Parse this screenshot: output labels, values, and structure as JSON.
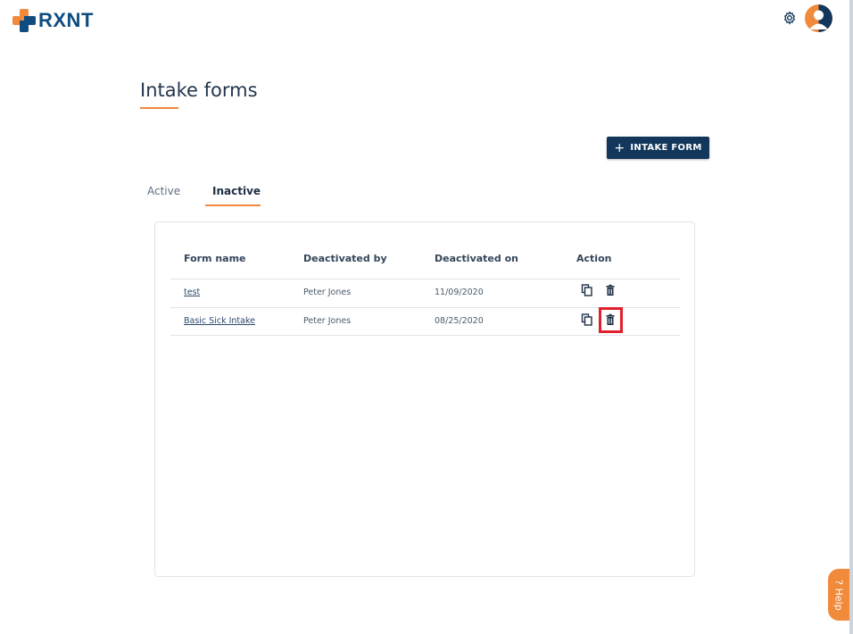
{
  "app": {
    "brand": "RXNT"
  },
  "header": {
    "settings_icon": "gear-icon",
    "avatar_icon": "user-avatar-icon"
  },
  "page": {
    "title": "Intake forms"
  },
  "toolbar": {
    "add_label": "INTAKE FORM",
    "add_icon": "plus-icon"
  },
  "tabs": [
    {
      "label": "Active",
      "selected": false
    },
    {
      "label": "Inactive",
      "selected": true
    }
  ],
  "table": {
    "columns": [
      "Form name",
      "Deactivated by",
      "Deactivated on",
      "Action"
    ],
    "rows": [
      {
        "form_name": "test",
        "deactivated_by": "Peter Jones",
        "deactivated_on": "11/09/2020",
        "actions": [
          "copy-icon",
          "trash-icon"
        ]
      },
      {
        "form_name": "Basic Sick Intake",
        "deactivated_by": "Peter Jones",
        "deactivated_on": "08/25/2020",
        "actions": [
          "copy-icon",
          "trash-icon"
        ]
      }
    ]
  },
  "help": {
    "label": "? Help"
  },
  "colors": {
    "accent": "#f28a3c",
    "primary": "#12375a",
    "brand_blue": "#0f4c81",
    "highlight": "#e0202a"
  }
}
